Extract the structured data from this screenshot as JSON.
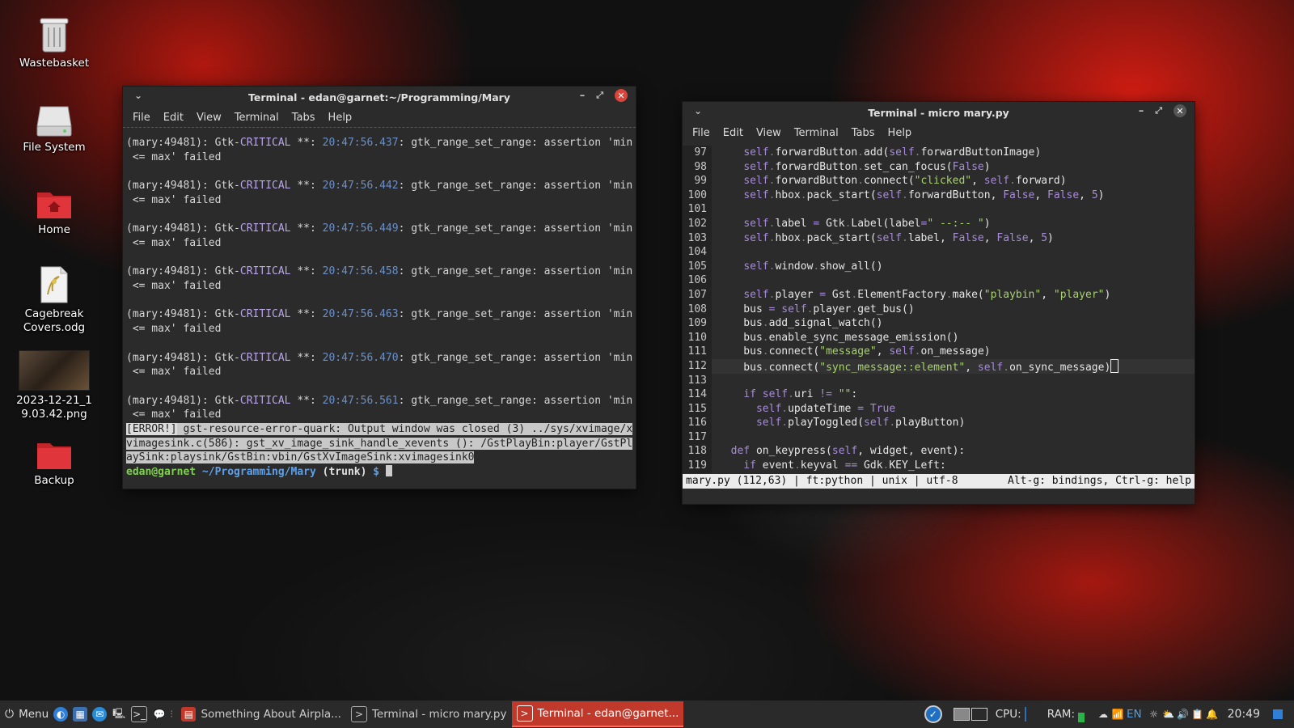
{
  "desktop": {
    "icons": [
      {
        "label": "Wastebasket"
      },
      {
        "label": "File System"
      },
      {
        "label": "Home"
      },
      {
        "label": "Cagebreak Covers.odg"
      },
      {
        "label": "2023-12-21_1 9.03.42.png"
      },
      {
        "label": "Backup"
      }
    ]
  },
  "terminal_left": {
    "title": "Terminal - edan@garnet:~/Programming/Mary",
    "menu": [
      "File",
      "Edit",
      "View",
      "Terminal",
      "Tabs",
      "Help"
    ],
    "log_prefix": "(mary:49481): Gtk-",
    "log_level": "CRITICAL",
    "log_sep": " **: ",
    "log_msg": ": gtk_range_set_range: assertion 'min",
    "log_cont": " <= max' failed",
    "timestamps": [
      "20:47:56.437",
      "20:47:56.442",
      "20:47:56.449",
      "20:47:56.458",
      "20:47:56.463",
      "20:47:56.470",
      "20:47:56.561"
    ],
    "error_tag": "[ERROR!]",
    "error_line1": " gst-resource-error-quark: Output window was closed (3) ../sys/xvimage/x",
    "error_line2": "vimagesink.c(586): gst_xv_image_sink_handle_xevents (): /GstPlayBin:player/GstPl",
    "error_line3": "aySink:playsink/GstBin:vbin/GstXvImageSink:xvimagesink0",
    "prompt_user": "edan@garnet",
    "prompt_path": " ~/Programming/Mary",
    "prompt_branch": " (trunk)",
    "prompt_symbol": " $ "
  },
  "terminal_right": {
    "title": "Terminal - micro mary.py",
    "menu": [
      "File",
      "Edit",
      "View",
      "Terminal",
      "Tabs",
      "Help"
    ],
    "lines": [
      {
        "n": "97",
        "code": "    self.forwardButton.add(self.forwardButtonImage)"
      },
      {
        "n": "98",
        "code": "    self.forwardButton.set_can_focus(False)"
      },
      {
        "n": "99",
        "code": "    self.forwardButton.connect(\"clicked\", self.forward)"
      },
      {
        "n": "100",
        "code": "    self.hbox.pack_start(self.forwardButton, False, False, 5)"
      },
      {
        "n": "101",
        "code": ""
      },
      {
        "n": "102",
        "code": "    self.label = Gtk.Label(label=\" --:-- \")"
      },
      {
        "n": "103",
        "code": "    self.hbox.pack_start(self.label, False, False, 5)"
      },
      {
        "n": "104",
        "code": ""
      },
      {
        "n": "105",
        "code": "    self.window.show_all()"
      },
      {
        "n": "106",
        "code": ""
      },
      {
        "n": "107",
        "code": "    self.player = Gst.ElementFactory.make(\"playbin\", \"player\")"
      },
      {
        "n": "108",
        "code": "    bus = self.player.get_bus()"
      },
      {
        "n": "109",
        "code": "    bus.add_signal_watch()"
      },
      {
        "n": "110",
        "code": "    bus.enable_sync_message_emission()"
      },
      {
        "n": "111",
        "code": "    bus.connect(\"message\", self.on_message)"
      },
      {
        "n": "112",
        "code": "    bus.connect(\"sync_message::element\", self.on_sync_message)"
      },
      {
        "n": "113",
        "code": ""
      },
      {
        "n": "114",
        "code": "    if self.uri != \"\":"
      },
      {
        "n": "115",
        "code": "      self.updateTime = True"
      },
      {
        "n": "116",
        "code": "      self.playToggled(self.playButton)"
      },
      {
        "n": "117",
        "code": ""
      },
      {
        "n": "118",
        "code": "  def on_keypress(self, widget, event):"
      },
      {
        "n": "119",
        "code": "    if event.keyval == Gdk.KEY_Left:"
      }
    ],
    "status_left": "mary.py (112,63) | ft:python | unix | utf-8",
    "status_right": "Alt-g: bindings, Ctrl-g: help"
  },
  "panel": {
    "menu_label": "Menu",
    "tasks": [
      {
        "label": "Something About Airpla...",
        "active": false
      },
      {
        "label": "Terminal - micro mary.py",
        "active": false
      },
      {
        "label": "Terminal - edan@garnet...",
        "active": true
      }
    ],
    "cpu_label": "CPU:",
    "ram_label": "RAM:",
    "lang": "EN",
    "clock": "20:49"
  },
  "colors": {
    "accent": "#c0392b",
    "close": "#d9453b"
  }
}
